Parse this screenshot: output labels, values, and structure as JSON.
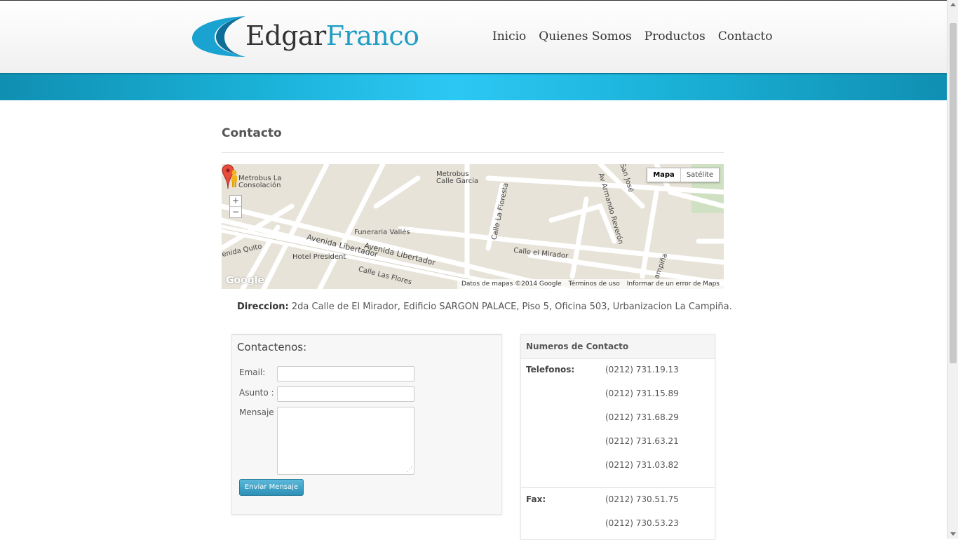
{
  "brand": {
    "part1": "Edgar",
    "part2": "Franco"
  },
  "nav": [
    "Inicio",
    "Quienes Somos",
    "Productos",
    "Contacto"
  ],
  "page_title": "Contacto",
  "map": {
    "type_buttons": [
      "Mapa",
      "Satélite"
    ],
    "active_type": "Mapa",
    "zoom_in": "+",
    "zoom_out": "−",
    "labels": {
      "metrobus_consolacion": "Metrobus La\nConsolación",
      "metrobus_garcia": "Metrobus\nCalle Garcia",
      "funeraria": "Funeraria Vallés",
      "hotel": "Hotel President",
      "av_libertador_1": "Avenida Libertador",
      "av_libertador_2": "Avenida Libertador",
      "calle_floresta": "Calle La Floresta",
      "calle_mirador": "Calle el Mirador",
      "calle_flores": "Calle Las Flores",
      "av_quito": "enida Quito",
      "av_armando": "Av Armando Reverón",
      "san_jose": "San José",
      "campiña": "ampiña"
    },
    "footer": [
      "Datos de mapas ©2014 Google",
      "Términos de uso",
      "Informar de un error de Maps"
    ],
    "google_logo": "Google"
  },
  "address": {
    "label": "Direccion:",
    "text": "2da Calle de El Mirador, Edificio SARGON PALACE, Piso 5, Oficina 503, Urbanizacion La Campiña."
  },
  "contact_form": {
    "title": "Contactenos:",
    "email_label": "Email:",
    "subject_label": "Asunto :",
    "message_label": "Mensaje",
    "submit": "Enviar Mensaje"
  },
  "contact_numbers": {
    "title": "Numeros de Contacto",
    "phones_label": "Telefonos:",
    "phones": [
      "(0212) 731.19.13",
      "(0212) 731.15.89",
      "(0212) 731.68.29",
      "(0212) 731.63.21",
      "(0212) 731.03.82"
    ],
    "fax_label": "Fax:",
    "fax": [
      "(0212) 730.51.75",
      "(0212) 730.53.23"
    ]
  },
  "colors": {
    "accent": "#1e9ec4",
    "band": "#2cc8f4",
    "button": "#2d8fb5"
  }
}
